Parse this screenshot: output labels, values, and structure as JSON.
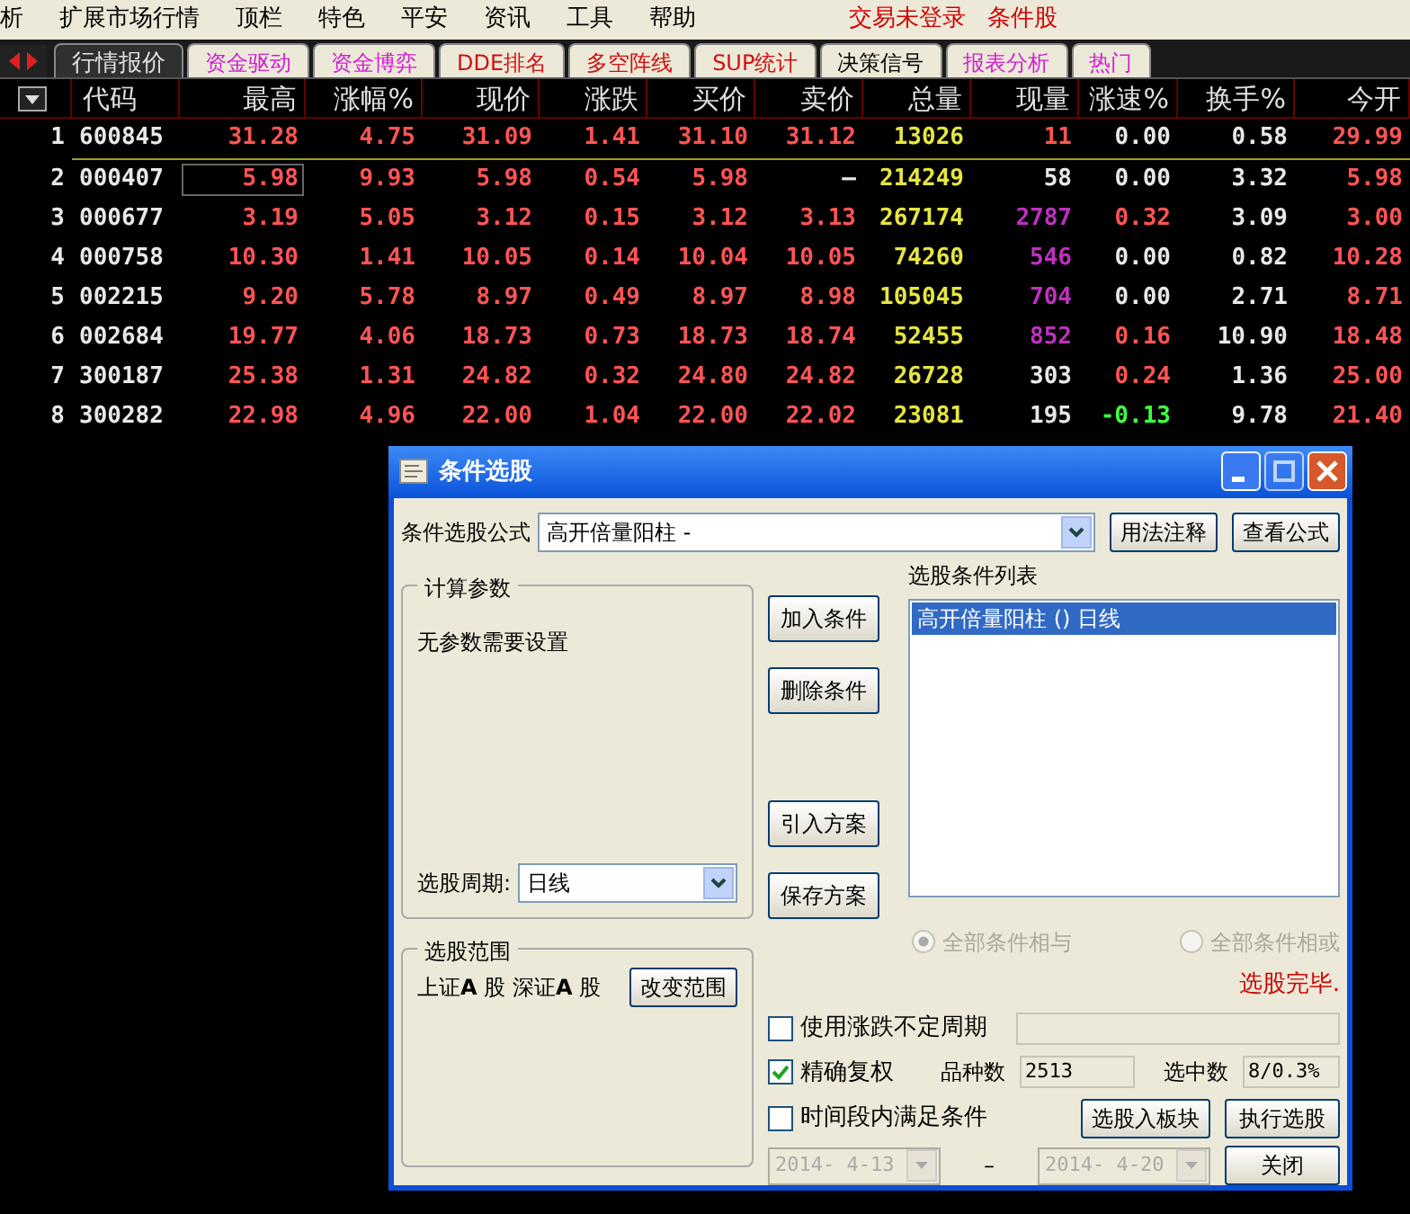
{
  "menu": [
    "析",
    "扩展市场行情",
    "顶栏",
    "特色",
    "平安",
    "资讯",
    "工具",
    "帮助"
  ],
  "menu_right": [
    "交易未登录",
    "条件股"
  ],
  "tabs": [
    {
      "label": "行情报价",
      "selected": true,
      "color": "#e0e0e0"
    },
    {
      "label": "资金驱动",
      "selected": false,
      "color": "#d020d0"
    },
    {
      "label": "资金博弈",
      "selected": false,
      "color": "#d020d0"
    },
    {
      "label": "DDE排名",
      "selected": false,
      "color": "#d01010"
    },
    {
      "label": "多空阵线",
      "selected": false,
      "color": "#d01010"
    },
    {
      "label": "SUP统计",
      "selected": false,
      "color": "#d01010"
    },
    {
      "label": "决策信号",
      "selected": false,
      "color": "#000000"
    },
    {
      "label": "报表分析",
      "selected": false,
      "color": "#d020d0"
    },
    {
      "label": "热门",
      "selected": false,
      "color": "#d020d0"
    }
  ],
  "table": {
    "columns": [
      "代码",
      "最高",
      "涨幅%",
      "现价",
      "涨跌",
      "买价",
      "卖价",
      "总量",
      "现量",
      "涨速%",
      "换手%",
      "今开"
    ],
    "rows": [
      {
        "index": "1",
        "cells": [
          {
            "text": "600845",
            "color": "#e8e8e8"
          },
          {
            "text": "31.28",
            "color": "#ff5454"
          },
          {
            "text": "4.75",
            "color": "#ff5454"
          },
          {
            "text": "31.09",
            "color": "#ff5454"
          },
          {
            "text": "1.41",
            "color": "#ff5454"
          },
          {
            "text": "31.10",
            "color": "#ff5454"
          },
          {
            "text": "31.12",
            "color": "#ff5454"
          },
          {
            "text": "13026",
            "color": "#e6e640"
          },
          {
            "text": "11",
            "color": "#ff5454"
          },
          {
            "text": "0.00",
            "color": "#e8e8e8"
          },
          {
            "text": "0.58",
            "color": "#e8e8e8"
          },
          {
            "text": "29.99",
            "color": "#ff5454"
          }
        ]
      },
      {
        "index": "2",
        "cells": [
          {
            "text": "000407",
            "color": "#e8e8e8"
          },
          {
            "text": "5.98",
            "color": "#ff5454",
            "boxed": true
          },
          {
            "text": "9.93",
            "color": "#ff5454"
          },
          {
            "text": "5.98",
            "color": "#ff5454"
          },
          {
            "text": "0.54",
            "color": "#ff5454"
          },
          {
            "text": "5.98",
            "color": "#ff5454"
          },
          {
            "text": "–",
            "color": "#e8e8e8"
          },
          {
            "text": "214249",
            "color": "#e6e640"
          },
          {
            "text": "58",
            "color": "#e8e8e8"
          },
          {
            "text": "0.00",
            "color": "#e8e8e8"
          },
          {
            "text": "3.32",
            "color": "#e8e8e8"
          },
          {
            "text": "5.98",
            "color": "#ff5454"
          }
        ]
      },
      {
        "index": "3",
        "cells": [
          {
            "text": "000677",
            "color": "#e8e8e8"
          },
          {
            "text": "3.19",
            "color": "#ff5454"
          },
          {
            "text": "5.05",
            "color": "#ff5454"
          },
          {
            "text": "3.12",
            "color": "#ff5454"
          },
          {
            "text": "0.15",
            "color": "#ff5454"
          },
          {
            "text": "3.12",
            "color": "#ff5454"
          },
          {
            "text": "3.13",
            "color": "#ff5454"
          },
          {
            "text": "267174",
            "color": "#e6e640"
          },
          {
            "text": "2787",
            "color": "#c030c0"
          },
          {
            "text": "0.32",
            "color": "#ff5454"
          },
          {
            "text": "3.09",
            "color": "#e8e8e8"
          },
          {
            "text": "3.00",
            "color": "#ff5454"
          }
        ]
      },
      {
        "index": "4",
        "cells": [
          {
            "text": "000758",
            "color": "#e8e8e8"
          },
          {
            "text": "10.30",
            "color": "#ff5454"
          },
          {
            "text": "1.41",
            "color": "#ff5454"
          },
          {
            "text": "10.05",
            "color": "#ff5454"
          },
          {
            "text": "0.14",
            "color": "#ff5454"
          },
          {
            "text": "10.04",
            "color": "#ff5454"
          },
          {
            "text": "10.05",
            "color": "#ff5454"
          },
          {
            "text": "74260",
            "color": "#e6e640"
          },
          {
            "text": "546",
            "color": "#c030c0"
          },
          {
            "text": "0.00",
            "color": "#e8e8e8"
          },
          {
            "text": "0.82",
            "color": "#e8e8e8"
          },
          {
            "text": "10.28",
            "color": "#ff5454"
          }
        ]
      },
      {
        "index": "5",
        "cells": [
          {
            "text": "002215",
            "color": "#e8e8e8"
          },
          {
            "text": "9.20",
            "color": "#ff5454"
          },
          {
            "text": "5.78",
            "color": "#ff5454"
          },
          {
            "text": "8.97",
            "color": "#ff5454"
          },
          {
            "text": "0.49",
            "color": "#ff5454"
          },
          {
            "text": "8.97",
            "color": "#ff5454"
          },
          {
            "text": "8.98",
            "color": "#ff5454"
          },
          {
            "text": "105045",
            "color": "#e6e640"
          },
          {
            "text": "704",
            "color": "#c030c0"
          },
          {
            "text": "0.00",
            "color": "#e8e8e8"
          },
          {
            "text": "2.71",
            "color": "#e8e8e8"
          },
          {
            "text": "8.71",
            "color": "#ff5454"
          }
        ]
      },
      {
        "index": "6",
        "cells": [
          {
            "text": "002684",
            "color": "#e8e8e8"
          },
          {
            "text": "19.77",
            "color": "#ff5454"
          },
          {
            "text": "4.06",
            "color": "#ff5454"
          },
          {
            "text": "18.73",
            "color": "#ff5454"
          },
          {
            "text": "0.73",
            "color": "#ff5454"
          },
          {
            "text": "18.73",
            "color": "#ff5454"
          },
          {
            "text": "18.74",
            "color": "#ff5454"
          },
          {
            "text": "52455",
            "color": "#e6e640"
          },
          {
            "text": "852",
            "color": "#c030c0"
          },
          {
            "text": "0.16",
            "color": "#ff5454"
          },
          {
            "text": "10.90",
            "color": "#e8e8e8"
          },
          {
            "text": "18.48",
            "color": "#ff5454"
          }
        ]
      },
      {
        "index": "7",
        "cells": [
          {
            "text": "300187",
            "color": "#e8e8e8"
          },
          {
            "text": "25.38",
            "color": "#ff5454"
          },
          {
            "text": "1.31",
            "color": "#ff5454"
          },
          {
            "text": "24.82",
            "color": "#ff5454"
          },
          {
            "text": "0.32",
            "color": "#ff5454"
          },
          {
            "text": "24.80",
            "color": "#ff5454"
          },
          {
            "text": "24.82",
            "color": "#ff5454"
          },
          {
            "text": "26728",
            "color": "#e6e640"
          },
          {
            "text": "303",
            "color": "#e8e8e8"
          },
          {
            "text": "0.24",
            "color": "#ff5454"
          },
          {
            "text": "1.36",
            "color": "#e8e8e8"
          },
          {
            "text": "25.00",
            "color": "#ff5454"
          }
        ]
      },
      {
        "index": "8",
        "cells": [
          {
            "text": "300282",
            "color": "#e8e8e8"
          },
          {
            "text": "22.98",
            "color": "#ff5454"
          },
          {
            "text": "4.96",
            "color": "#ff5454"
          },
          {
            "text": "22.00",
            "color": "#ff5454"
          },
          {
            "text": "1.04",
            "color": "#ff5454"
          },
          {
            "text": "22.00",
            "color": "#ff5454"
          },
          {
            "text": "22.02",
            "color": "#ff5454"
          },
          {
            "text": "23081",
            "color": "#e6e640"
          },
          {
            "text": "195",
            "color": "#e8e8e8"
          },
          {
            "text": "-0.13",
            "color": "#40ff40"
          },
          {
            "text": "9.78",
            "color": "#e8e8e8"
          },
          {
            "text": "21.40",
            "color": "#ff5454"
          }
        ]
      }
    ]
  },
  "dialog": {
    "title": "条件选股",
    "formula_label": "条件选股公式",
    "formula_value": "高开倍量阳柱 -",
    "top_buttons": [
      "用法注释",
      "查看公式"
    ],
    "params_group": {
      "title": "计算参数",
      "text": "无参数需要设置",
      "period_label": "选股周期:",
      "period_value": "日线"
    },
    "range_group": {
      "title": "选股范围",
      "text": "上证**A** 股 深证**A** 股",
      "button": "改变范围"
    },
    "side_buttons": [
      "加入条件",
      "删除条件",
      "引入方案",
      "保存方案"
    ],
    "list_label": "选股条件列表",
    "list_items": [
      {
        "text": "高开倍量阳柱 () 日线",
        "selected": true
      }
    ],
    "radios": [
      {
        "label": "全部条件相与",
        "checked": true,
        "disabled": true
      },
      {
        "label": "全部条件相或",
        "checked": false,
        "disabled": true
      }
    ],
    "status": "选股完毕.",
    "progress": {
      "level": 0
    },
    "checkboxes": [
      {
        "label": "使用涨跌不定周期",
        "checked": false
      },
      {
        "label": "精确复权",
        "checked": true
      },
      {
        "label": "时间段内满足条件",
        "checked": false
      }
    ],
    "count_label": "品种数",
    "count_value": "2513",
    "picked_label": "选中数",
    "picked_value": "8/0.3%",
    "buttons": [
      "选股入板块",
      "执行选股",
      "关闭"
    ],
    "date_from": "2014- 4-13",
    "date_sep": "–",
    "date_to": "2014- 4-20"
  }
}
